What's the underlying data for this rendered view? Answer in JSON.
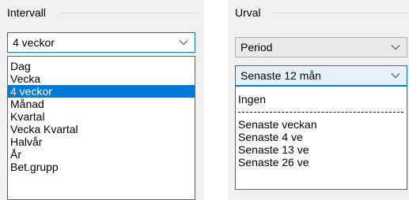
{
  "intervall": {
    "group_label": "Intervall",
    "selected_value": "4 veckor",
    "options": [
      {
        "label": "Dag",
        "selected": false
      },
      {
        "label": "Vecka",
        "selected": false
      },
      {
        "label": "4 veckor",
        "selected": true
      },
      {
        "label": "Månad",
        "selected": false
      },
      {
        "label": "Kvartal",
        "selected": false
      },
      {
        "label": "Vecka Kvartal",
        "selected": false
      },
      {
        "label": "Halvår",
        "selected": false
      },
      {
        "label": "År",
        "selected": false
      },
      {
        "label": "Bet.grupp",
        "selected": false
      }
    ]
  },
  "urval": {
    "group_label": "Urval",
    "period_value": "Period",
    "range_value": "Senaste 12 mån",
    "options": [
      {
        "label": "Ingen",
        "separator": false
      },
      {
        "label": "",
        "separator": true
      },
      {
        "label": "Senaste veckan",
        "separator": false
      },
      {
        "label": "Senaste 4 ve",
        "separator": false
      },
      {
        "label": "Senaste 13 ve",
        "separator": false
      },
      {
        "label": "Senaste 26 ve",
        "separator": false
      }
    ]
  },
  "colors": {
    "selection": "#0078d7",
    "focus_border": "#0078d7",
    "focus_fill": "#e5f1fb",
    "panel": "#f0f0f0"
  },
  "icons": {
    "dropdown_arrow": "chevron-down-icon"
  }
}
